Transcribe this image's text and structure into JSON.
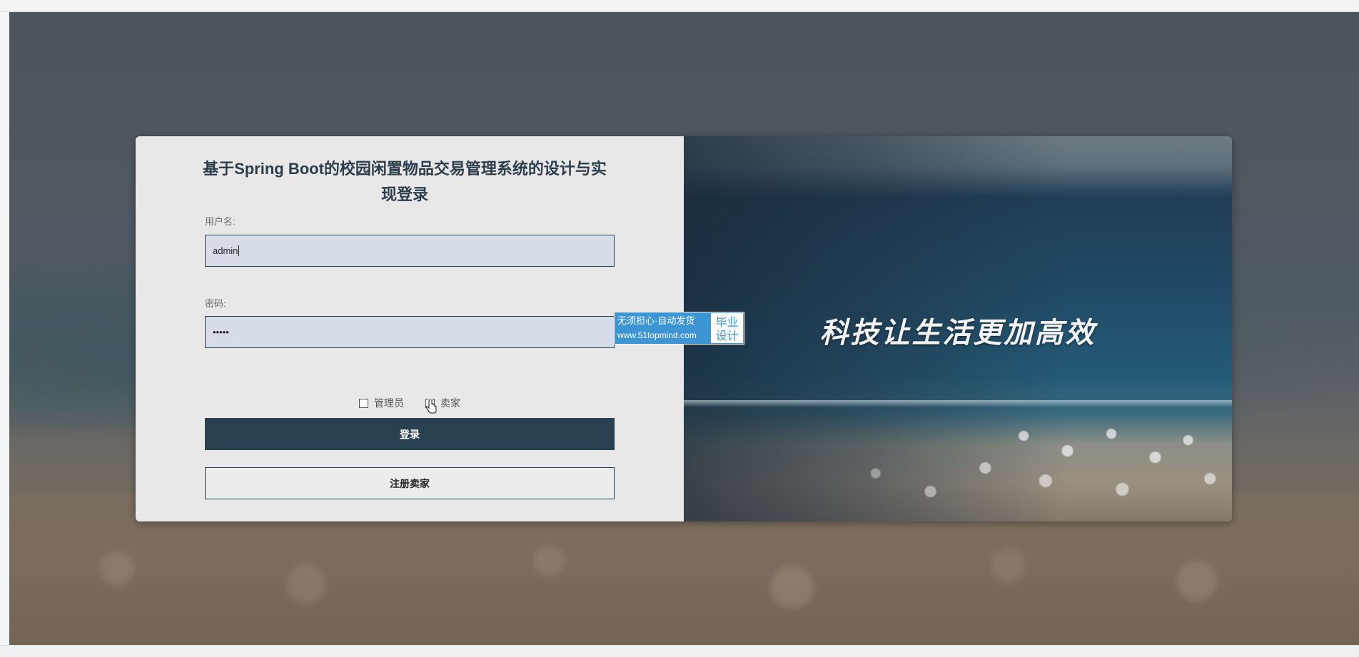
{
  "app": {
    "title": "基于Spring Boot的校园闲置物品交易管理系统的设计与实现登录"
  },
  "form": {
    "username_label": "用户名:",
    "username_value": "admin",
    "password_label": "密码:",
    "password_value": "•••••",
    "roles": [
      {
        "label": "管理员",
        "checked": false
      },
      {
        "label": "卖家",
        "checked": false
      }
    ],
    "login_button": "登录",
    "register_button": "注册卖家"
  },
  "banner": {
    "slogan": "科技让生活更加高效"
  },
  "watermark": {
    "line1": "无须担心·自动发货",
    "line2": "www.51topmind.com",
    "side": "毕业设计"
  },
  "colors": {
    "primary": "#28404f",
    "input_bg": "#d7dde8",
    "panel_bg": "#e8e8e8",
    "badge": "#3d95d3"
  }
}
